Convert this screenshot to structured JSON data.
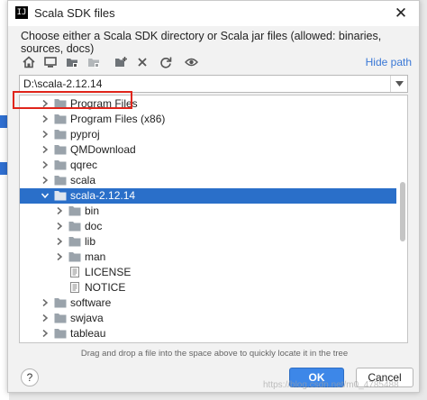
{
  "dialog": {
    "title": "Scala SDK files",
    "logo_text": "IJ",
    "close_glyph": "✕",
    "description": "Choose either a Scala SDK directory or Scala jar files (allowed: binaries, sources, docs)"
  },
  "toolbar": {
    "icons": [
      "home-icon",
      "desktop-icon",
      "project-folder-icon",
      "module-folder-icon",
      "new-folder-icon",
      "delete-icon",
      "refresh-icon",
      "show-hidden-icon"
    ],
    "hide_path_label": "Hide path"
  },
  "path": {
    "value": "D:\\scala-2.12.14"
  },
  "tree": {
    "rows": [
      {
        "label": "Program Files",
        "level": 0,
        "state": "collapsed",
        "type": "folder"
      },
      {
        "label": "Program Files (x86)",
        "level": 0,
        "state": "collapsed",
        "type": "folder"
      },
      {
        "label": "pyproj",
        "level": 0,
        "state": "collapsed",
        "type": "folder"
      },
      {
        "label": "QMDownload",
        "level": 0,
        "state": "collapsed",
        "type": "folder"
      },
      {
        "label": "qqrec",
        "level": 0,
        "state": "collapsed",
        "type": "folder"
      },
      {
        "label": "scala",
        "level": 0,
        "state": "collapsed",
        "type": "folder"
      },
      {
        "label": "scala-2.12.14",
        "level": 0,
        "state": "expanded",
        "type": "folder",
        "selected": true
      },
      {
        "label": "bin",
        "level": 1,
        "state": "collapsed",
        "type": "folder"
      },
      {
        "label": "doc",
        "level": 1,
        "state": "collapsed",
        "type": "folder"
      },
      {
        "label": "lib",
        "level": 1,
        "state": "collapsed",
        "type": "folder"
      },
      {
        "label": "man",
        "level": 1,
        "state": "collapsed",
        "type": "folder"
      },
      {
        "label": "LICENSE",
        "level": 1,
        "state": "none",
        "type": "file"
      },
      {
        "label": "NOTICE",
        "level": 1,
        "state": "none",
        "type": "file"
      },
      {
        "label": "software",
        "level": 0,
        "state": "collapsed",
        "type": "folder"
      },
      {
        "label": "swjava",
        "level": 0,
        "state": "collapsed",
        "type": "folder"
      },
      {
        "label": "tableau",
        "level": 0,
        "state": "collapsed",
        "type": "folder"
      }
    ]
  },
  "hint": "Drag and drop a file into the space above to quickly locate it in the tree",
  "buttons": {
    "help": "?",
    "ok": "OK",
    "cancel": "Cancel"
  },
  "watermark": "https://blog.csdn.net/m0_4785488",
  "colors": {
    "selection": "#2a6fc9",
    "link": "#3a78d6",
    "highlight_box": "#e0251b",
    "ok_button": "#3d87e8",
    "folder": "#9aa3ab"
  }
}
